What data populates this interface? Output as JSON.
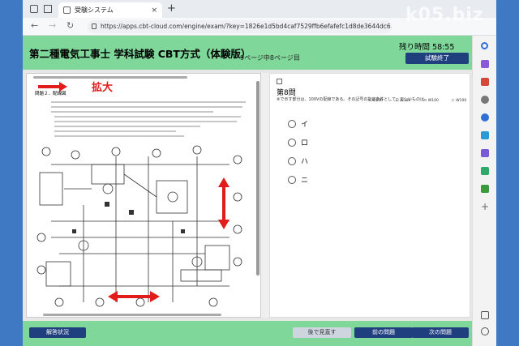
{
  "browser": {
    "tab_title": "受験システム",
    "tab_close": "×",
    "new_tab": "+",
    "back": "←",
    "forward": "→",
    "reload": "↻",
    "url": "https://apps.cbt-cloud.com/engine/exam/?key=1826e1d5bd4caf7529ffb6efafefc1d8de3644dc6169&t..."
  },
  "header": {
    "title": "第二種電気工事士 学科試験 CBT方式（体験版）",
    "page_indicator": "9ページ中8ページ目",
    "timer": "残り時間 58:55",
    "end_button": "試験終了"
  },
  "left_pane": {
    "question_label": "問題２．配線図",
    "zoom_label": "拡大"
  },
  "question": {
    "number": "第8問",
    "text": "⑧で示す部分は、100Vの配線である。その記号の指定条件として、正しいものは。",
    "option_row": [
      "イ W100",
      "ロ W100",
      "ハ W100",
      "ニ W100"
    ],
    "options": [
      {
        "key": "i",
        "label": "イ"
      },
      {
        "key": "ro",
        "label": "ロ"
      },
      {
        "key": "ha",
        "label": "ハ"
      },
      {
        "key": "ni",
        "label": "ニ"
      }
    ]
  },
  "footer": {
    "status": "解答状況",
    "later": "後で見直す",
    "prev": "前の問題",
    "next": "次の問題"
  },
  "watermark": "k05.biz",
  "colors": {
    "header_bg": "#7fd79a",
    "button_dark": "#1f3f7f",
    "annotation_red": "#e21b1b"
  }
}
